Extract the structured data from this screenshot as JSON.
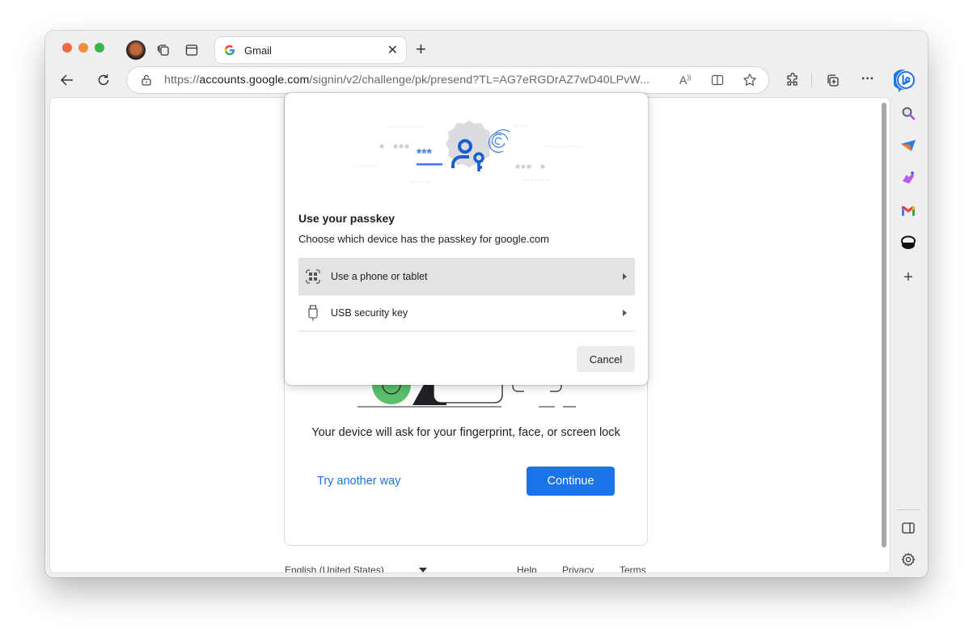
{
  "browser": {
    "tab": {
      "title": "Gmail",
      "favicon": "google-g-icon"
    },
    "address_bar": {
      "url_prefix": "https://",
      "url_domain": "accounts.google.com",
      "url_path": "/signin/v2/challenge/pk/presend?TL=AG7eRGDrAZ7wD40LPvW..."
    },
    "toolbar_icons": [
      "back-icon",
      "reload-icon",
      "read-aloud-icon",
      "split-screen-icon",
      "favorite-star-icon",
      "extensions-icon",
      "collections-icon",
      "more-icon",
      "bing-copilot-icon"
    ],
    "sidebar_icons": [
      "search-icon",
      "telegram-icon",
      "games-icon",
      "gmail-icon",
      "outlook-icon",
      "add-icon",
      "sidebar-toggle-icon",
      "settings-icon"
    ],
    "more_label": "···"
  },
  "page": {
    "device_text": "Your device will ask for your fingerprint, face, or screen lock",
    "try_another_way": "Try another way",
    "continue_label": "Continue",
    "footer": {
      "language": "English (United States)",
      "links": [
        "Help",
        "Privacy",
        "Terms"
      ]
    }
  },
  "passkey_dialog": {
    "title": "Use your passkey",
    "subtitle": "Choose which device has the passkey for google.com",
    "options": [
      {
        "label": "Use a phone or tablet",
        "icon": "qr-code-icon",
        "selected": true
      },
      {
        "label": "USB security key",
        "icon": "usb-key-icon",
        "selected": false
      }
    ],
    "cancel_label": "Cancel",
    "password_mask": "***"
  },
  "colors": {
    "accent": "#1a73e8",
    "passkey_blue": "#1a5fd0",
    "selected_row": "#e3e3e3"
  }
}
